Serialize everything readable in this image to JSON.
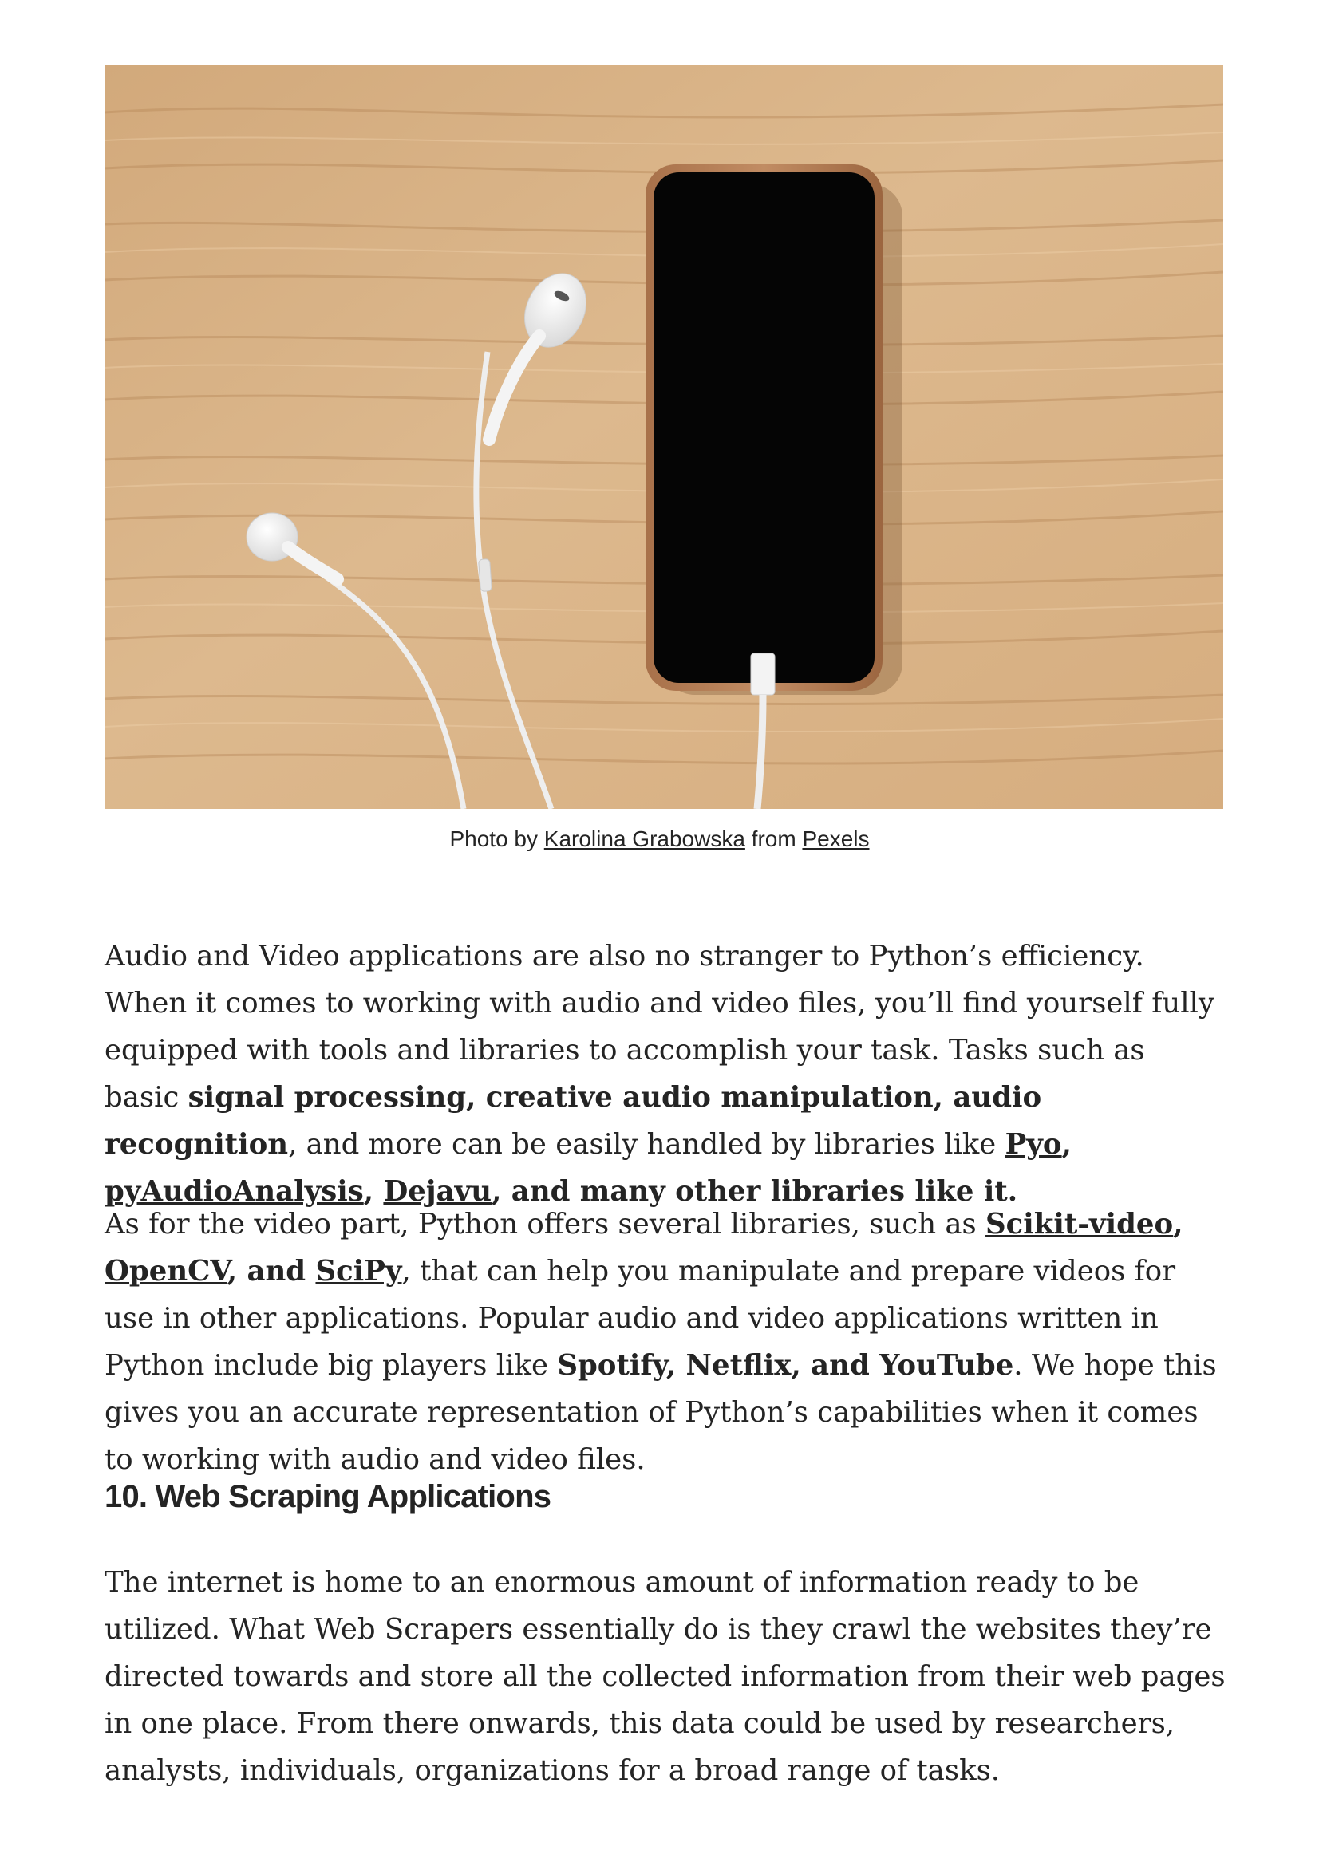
{
  "image": {
    "description_icon": "phone-earphones-photo"
  },
  "caption": {
    "prefix": "Photo by ",
    "author_link": "Karolina Grabowska",
    "middle": " from ",
    "source_link": "Pexels"
  },
  "para1": {
    "t1": "Audio and Video applications are also no stranger to Python’s efficiency. When it comes to working with audio and video files, you’ll find yourself fully equipped with tools and libraries to accomplish your task. Tasks such as basic ",
    "b1": "signal processing, creative audio manipulation, audio recognition",
    "t2": ", and more can be easily handled by libraries like ",
    "l1": "Pyo",
    "s1": ", ",
    "l2": "pyAudioAnalysis",
    "s2": ", ",
    "l3": "Dejavu",
    "b2": ", and many other libraries like it."
  },
  "para2": {
    "t1": "As for the video part, Python offers several libraries, such as ",
    "l1": "Scikit-video",
    "s1": ", ",
    "l2": "OpenCV",
    "b1": ", and ",
    "l3": "SciPy",
    "t2": ", that can help you manipulate and prepare videos for use in other applications. Popular audio and video applications written in Python include big players like ",
    "b2": "Spotify, Netflix, and YouTube",
    "t3": ". We hope this gives you an accurate representation of Python’s capabilities when it comes to working with audio and video files."
  },
  "heading": "10. Web Scraping Applications",
  "para3": "The internet is home to an enormous amount of information ready to be utilized. What Web Scrapers essentially do is they crawl the websites they’re directed towards and store all the collected information from their web pages in one place. From there onwards, this data could be used by researchers, analysts, individuals, organizations for a broad range of tasks.",
  "colors": {
    "text": "#242424",
    "wood": "#d9b387",
    "phone_case": "#b7835e",
    "screen": "#050505"
  }
}
